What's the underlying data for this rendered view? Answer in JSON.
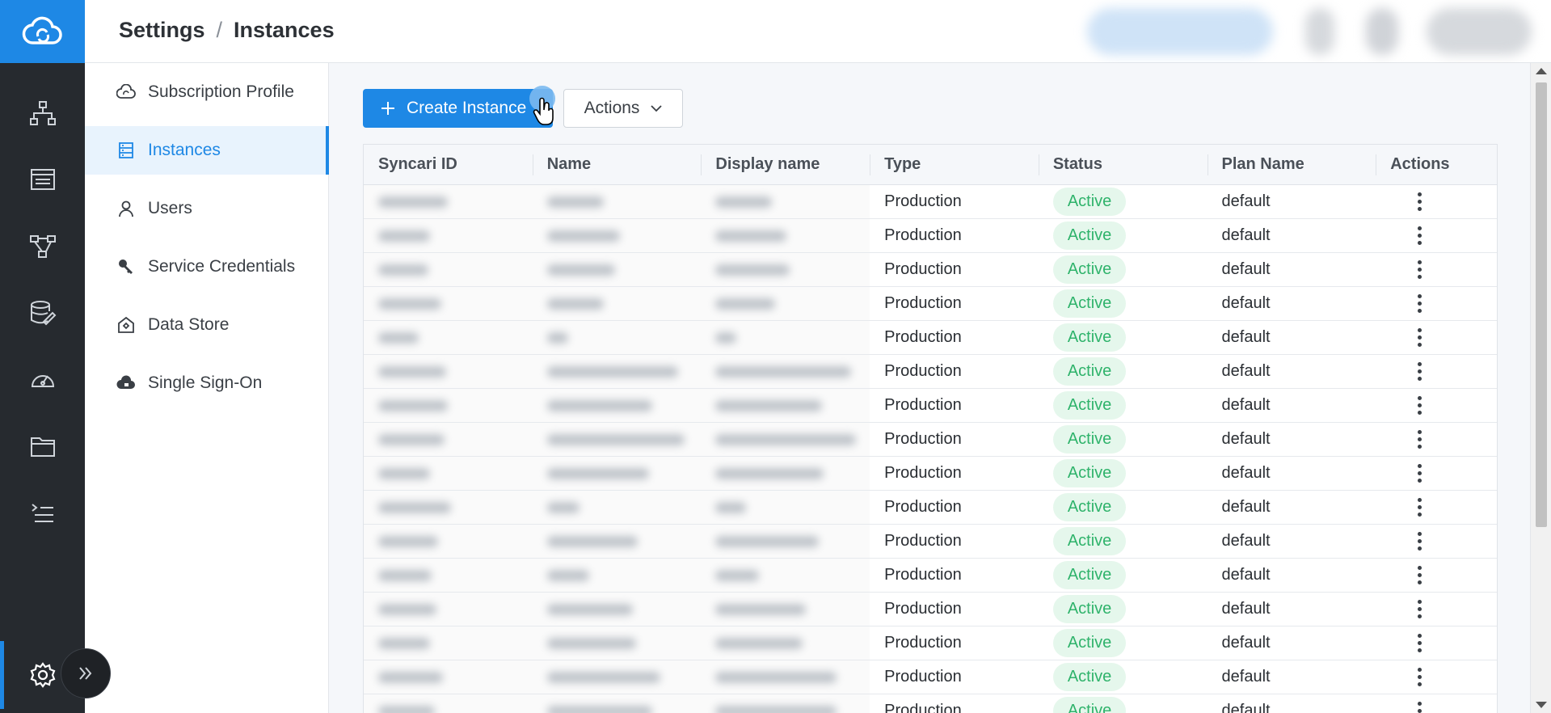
{
  "header": {
    "breadcrumb": [
      "Settings",
      "Instances"
    ],
    "separator": "/"
  },
  "rail": {
    "icons": [
      "cloud-sync-icon",
      "hierarchy-icon",
      "list-window-icon",
      "workflow-icon",
      "database-edit-icon",
      "dashboard-gauge-icon",
      "folder-icon",
      "console-list-icon",
      "settings-gear-icon",
      "double-chevron-right-icon"
    ]
  },
  "subnav": {
    "items": [
      {
        "label": "Subscription Profile",
        "icon": "cloud-sync-icon"
      },
      {
        "label": "Instances",
        "icon": "server-list-icon"
      },
      {
        "label": "Users",
        "icon": "user-icon"
      },
      {
        "label": "Service Credentials",
        "icon": "key-icon"
      },
      {
        "label": "Data Store",
        "icon": "datastore-icon"
      },
      {
        "label": "Single Sign-On",
        "icon": "cloud-lock-icon"
      }
    ]
  },
  "toolbar": {
    "create_label": "Create Instance",
    "actions_label": "Actions"
  },
  "table": {
    "columns": [
      "Syncari ID",
      "Name",
      "Display name",
      "Type",
      "Status",
      "Plan Name",
      "Actions"
    ],
    "rows": [
      {
        "type": "Production",
        "status": "Active",
        "plan": "default"
      },
      {
        "type": "Production",
        "status": "Active",
        "plan": "default"
      },
      {
        "type": "Production",
        "status": "Active",
        "plan": "default"
      },
      {
        "type": "Production",
        "status": "Active",
        "plan": "default"
      },
      {
        "type": "Production",
        "status": "Active",
        "plan": "default"
      },
      {
        "type": "Production",
        "status": "Active",
        "plan": "default"
      },
      {
        "type": "Production",
        "status": "Active",
        "plan": "default"
      },
      {
        "type": "Production",
        "status": "Active",
        "plan": "default"
      },
      {
        "type": "Production",
        "status": "Active",
        "plan": "default"
      },
      {
        "type": "Production",
        "status": "Active",
        "plan": "default"
      },
      {
        "type": "Production",
        "status": "Active",
        "plan": "default"
      },
      {
        "type": "Production",
        "status": "Active",
        "plan": "default"
      },
      {
        "type": "Production",
        "status": "Active",
        "plan": "default"
      },
      {
        "type": "Production",
        "status": "Active",
        "plan": "default"
      },
      {
        "type": "Production",
        "status": "Active",
        "plan": "default"
      },
      {
        "type": "Production",
        "status": "Active",
        "plan": "default"
      }
    ]
  },
  "colors": {
    "accent": "#1e88e5",
    "rail_bg": "#262a2f",
    "active_badge_bg": "#e5f7ec",
    "active_badge_text": "#2fb36b"
  }
}
